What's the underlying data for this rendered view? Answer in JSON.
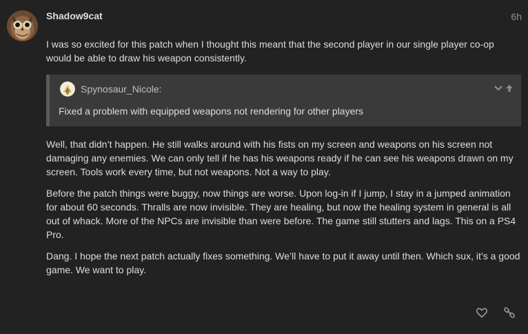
{
  "post": {
    "username": "Shadow9cat",
    "date": "6h",
    "avatar_icon": "owl-avatar-icon",
    "paragraphs": [
      "I was so excited for this patch when I thought this meant that the second player in our single player co-op would be able to draw his weapon consistently.",
      "Well, that didn’t happen. He still walks around with his fists on my screen and weapons on his screen not damaging any enemies. We can only tell if he has his weapons ready if he can see his weapons drawn on my screen. Tools work every time, but not weapons. Not a way to play.",
      "Before the patch things were buggy, now things are worse. Upon log-in if I jump, I stay in a jumped animation for about 60 seconds. Thralls are now invisible. They are healing, but now the healing system in general is all out of whack. More of the NPCs are invisible than were before. The game still stutters and lags. This on a PS4 Pro.",
      "Dang. I hope the next patch actually fixes something. We’ll have to put it away until then. Which sux, it’s a good game. We want to play."
    ],
    "quote": {
      "author": "Spynosaur_Nicole:",
      "text": "Fixed a problem with equipped weapons not rendering for other players",
      "avatar_icon": "spynosaur-avatar-icon",
      "expand_icon": "chevron-down-icon",
      "jump_icon": "arrow-up-icon"
    },
    "actions": {
      "like_icon": "heart-icon",
      "share_icon": "link-icon"
    }
  },
  "colors": {
    "background": "#222222",
    "text": "#dddddd",
    "muted": "#919191",
    "quote_bg": "#3a3a3a",
    "quote_border": "#5a5a5a"
  }
}
